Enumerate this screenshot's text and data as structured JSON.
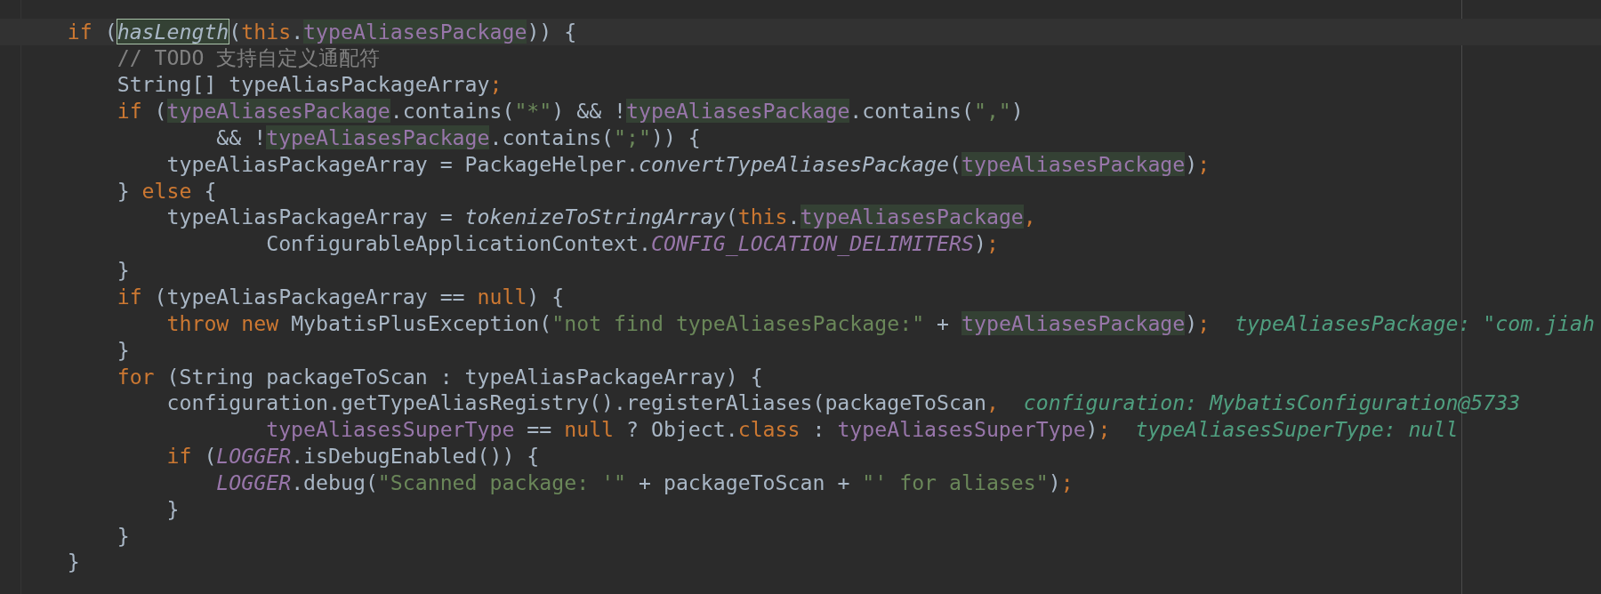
{
  "editor": {
    "lines": [
      {
        "current": true,
        "tokens": [
          {
            "text": "if",
            "kind": "keyword"
          },
          {
            "text": " (",
            "kind": "plain"
          },
          {
            "text": "hasLength",
            "kind": "method-boxed"
          },
          {
            "text": "(",
            "kind": "plain"
          },
          {
            "text": "this",
            "kind": "keyword"
          },
          {
            "text": ".",
            "kind": "plain"
          },
          {
            "text": "typeAliasesPackage",
            "kind": "field-usage"
          },
          {
            "text": ")) {",
            "kind": "plain"
          }
        ],
        "children": [
          {
            "current": false,
            "tokens": [
              {
                "text": "// TODO 支持自定义通配符",
                "kind": "comment"
              }
            ]
          },
          {
            "current": false,
            "tokens": [
              {
                "text": "String[] typeAliasPackageArray",
                "kind": "plain"
              },
              {
                "text": ";",
                "kind": "punct"
              }
            ]
          },
          {
            "current": false,
            "tokens": [
              {
                "text": "if",
                "kind": "keyword"
              },
              {
                "text": " (",
                "kind": "plain"
              },
              {
                "text": "typeAliasesPackage",
                "kind": "field-usage"
              },
              {
                "text": ".contains(",
                "kind": "plain"
              },
              {
                "text": "\"*\"",
                "kind": "string"
              },
              {
                "text": ") && !",
                "kind": "plain"
              },
              {
                "text": "typeAliasesPackage",
                "kind": "field-usage"
              },
              {
                "text": ".contains(",
                "kind": "plain"
              },
              {
                "text": "\",\"",
                "kind": "string"
              },
              {
                "text": ")",
                "kind": "plain"
              }
            ],
            "continuation": [
              {
                "current": false,
                "tokens": [
                  {
                    "text": "&& !",
                    "kind": "plain"
                  },
                  {
                    "text": "typeAliasesPackage",
                    "kind": "field-usage"
                  },
                  {
                    "text": ".contains(",
                    "kind": "plain"
                  },
                  {
                    "text": "\";\"",
                    "kind": "string"
                  },
                  {
                    "text": ")) {",
                    "kind": "plain"
                  }
                ]
              }
            ],
            "children": [
              {
                "current": false,
                "tokens": [
                  {
                    "text": "typeAliasPackageArray = PackageHelper.",
                    "kind": "plain"
                  },
                  {
                    "text": "convertTypeAliasesPackage",
                    "kind": "method"
                  },
                  {
                    "text": "(",
                    "kind": "plain"
                  },
                  {
                    "text": "typeAliasesPackage",
                    "kind": "field-usage"
                  },
                  {
                    "text": ")",
                    "kind": "plain"
                  },
                  {
                    "text": ";",
                    "kind": "punct"
                  }
                ]
              }
            ]
          },
          {
            "current": false,
            "tokens": [
              {
                "text": "} ",
                "kind": "plain"
              },
              {
                "text": "else",
                "kind": "keyword"
              },
              {
                "text": " {",
                "kind": "plain"
              }
            ],
            "children": [
              {
                "current": false,
                "tokens": [
                  {
                    "text": "typeAliasPackageArray = ",
                    "kind": "plain"
                  },
                  {
                    "text": "tokenizeToStringArray",
                    "kind": "method"
                  },
                  {
                    "text": "(",
                    "kind": "plain"
                  },
                  {
                    "text": "this",
                    "kind": "keyword"
                  },
                  {
                    "text": ".",
                    "kind": "plain"
                  },
                  {
                    "text": "typeAliasesPackage",
                    "kind": "field-usage"
                  },
                  {
                    "text": ",",
                    "kind": "punct"
                  }
                ],
                "continuation": [
                  {
                    "current": false,
                    "tokens": [
                      {
                        "text": "ConfigurableApplicationContext.",
                        "kind": "plain"
                      },
                      {
                        "text": "CONFIG_LOCATION_DELIMITERS",
                        "kind": "static"
                      },
                      {
                        "text": ")",
                        "kind": "plain"
                      },
                      {
                        "text": ";",
                        "kind": "punct"
                      }
                    ]
                  }
                ]
              }
            ]
          },
          {
            "current": false,
            "tokens": [
              {
                "text": "}",
                "kind": "plain"
              }
            ]
          },
          {
            "current": false,
            "tokens": [
              {
                "text": "if",
                "kind": "keyword"
              },
              {
                "text": " (typeAliasPackageArray == ",
                "kind": "plain"
              },
              {
                "text": "null",
                "kind": "keyword"
              },
              {
                "text": ") {",
                "kind": "plain"
              }
            ],
            "children": [
              {
                "current": false,
                "tokens": [
                  {
                    "text": "throw ",
                    "kind": "keyword"
                  },
                  {
                    "text": "new",
                    "kind": "keyword"
                  },
                  {
                    "text": " MybatisPlusException(",
                    "kind": "plain"
                  },
                  {
                    "text": "\"not find typeAliasesPackage:\"",
                    "kind": "string"
                  },
                  {
                    "text": " + ",
                    "kind": "plain"
                  },
                  {
                    "text": "typeAliasesPackage",
                    "kind": "field-usage"
                  },
                  {
                    "text": ")",
                    "kind": "plain"
                  },
                  {
                    "text": ";",
                    "kind": "punct"
                  }
                ],
                "hint": "typeAliasesPackage: \"com.jiah"
              }
            ]
          },
          {
            "current": false,
            "tokens": [
              {
                "text": "}",
                "kind": "plain"
              }
            ]
          },
          {
            "current": false,
            "tokens": [
              {
                "text": "for",
                "kind": "keyword"
              },
              {
                "text": " (String packageToScan : typeAliasPackageArray) {",
                "kind": "plain"
              }
            ],
            "children": [
              {
                "current": false,
                "tokens": [
                  {
                    "text": "configuration.getTypeAliasRegistry().registerAliases(packageToScan",
                    "kind": "plain"
                  },
                  {
                    "text": ",",
                    "kind": "punct"
                  }
                ],
                "hint": "configuration: MybatisConfiguration@5733",
                "continuation": [
                  {
                    "current": false,
                    "tokens": [
                      {
                        "text": "typeAliasesSuperType",
                        "kind": "field"
                      },
                      {
                        "text": " == ",
                        "kind": "plain"
                      },
                      {
                        "text": "null",
                        "kind": "keyword"
                      },
                      {
                        "text": " ? Object.",
                        "kind": "plain"
                      },
                      {
                        "text": "class",
                        "kind": "keyword"
                      },
                      {
                        "text": " : ",
                        "kind": "plain"
                      },
                      {
                        "text": "typeAliasesSuperType",
                        "kind": "field"
                      },
                      {
                        "text": ")",
                        "kind": "plain"
                      },
                      {
                        "text": ";",
                        "kind": "punct"
                      }
                    ],
                    "hint": "typeAliasesSuperType: null"
                  }
                ]
              },
              {
                "current": false,
                "tokens": [
                  {
                    "text": "if",
                    "kind": "keyword"
                  },
                  {
                    "text": " (",
                    "kind": "plain"
                  },
                  {
                    "text": "LOGGER",
                    "kind": "static"
                  },
                  {
                    "text": ".isDebugEnabled()) {",
                    "kind": "plain"
                  }
                ],
                "children": [
                  {
                    "current": false,
                    "tokens": [
                      {
                        "text": "LOGGER",
                        "kind": "static"
                      },
                      {
                        "text": ".debug(",
                        "kind": "plain"
                      },
                      {
                        "text": "\"Scanned package: '\"",
                        "kind": "string"
                      },
                      {
                        "text": " + packageToScan + ",
                        "kind": "plain"
                      },
                      {
                        "text": "\"' for aliases\"",
                        "kind": "string"
                      },
                      {
                        "text": ")",
                        "kind": "plain"
                      },
                      {
                        "text": ";",
                        "kind": "punct"
                      }
                    ]
                  }
                ]
              },
              {
                "current": false,
                "tokens": [
                  {
                    "text": "}",
                    "kind": "plain"
                  }
                ]
              }
            ]
          },
          {
            "current": false,
            "tokens": [
              {
                "text": "}",
                "kind": "plain"
              }
            ]
          }
        ]
      },
      {
        "current": false,
        "tokens": [
          {
            "text": "}",
            "kind": "plain"
          }
        ]
      }
    ]
  }
}
